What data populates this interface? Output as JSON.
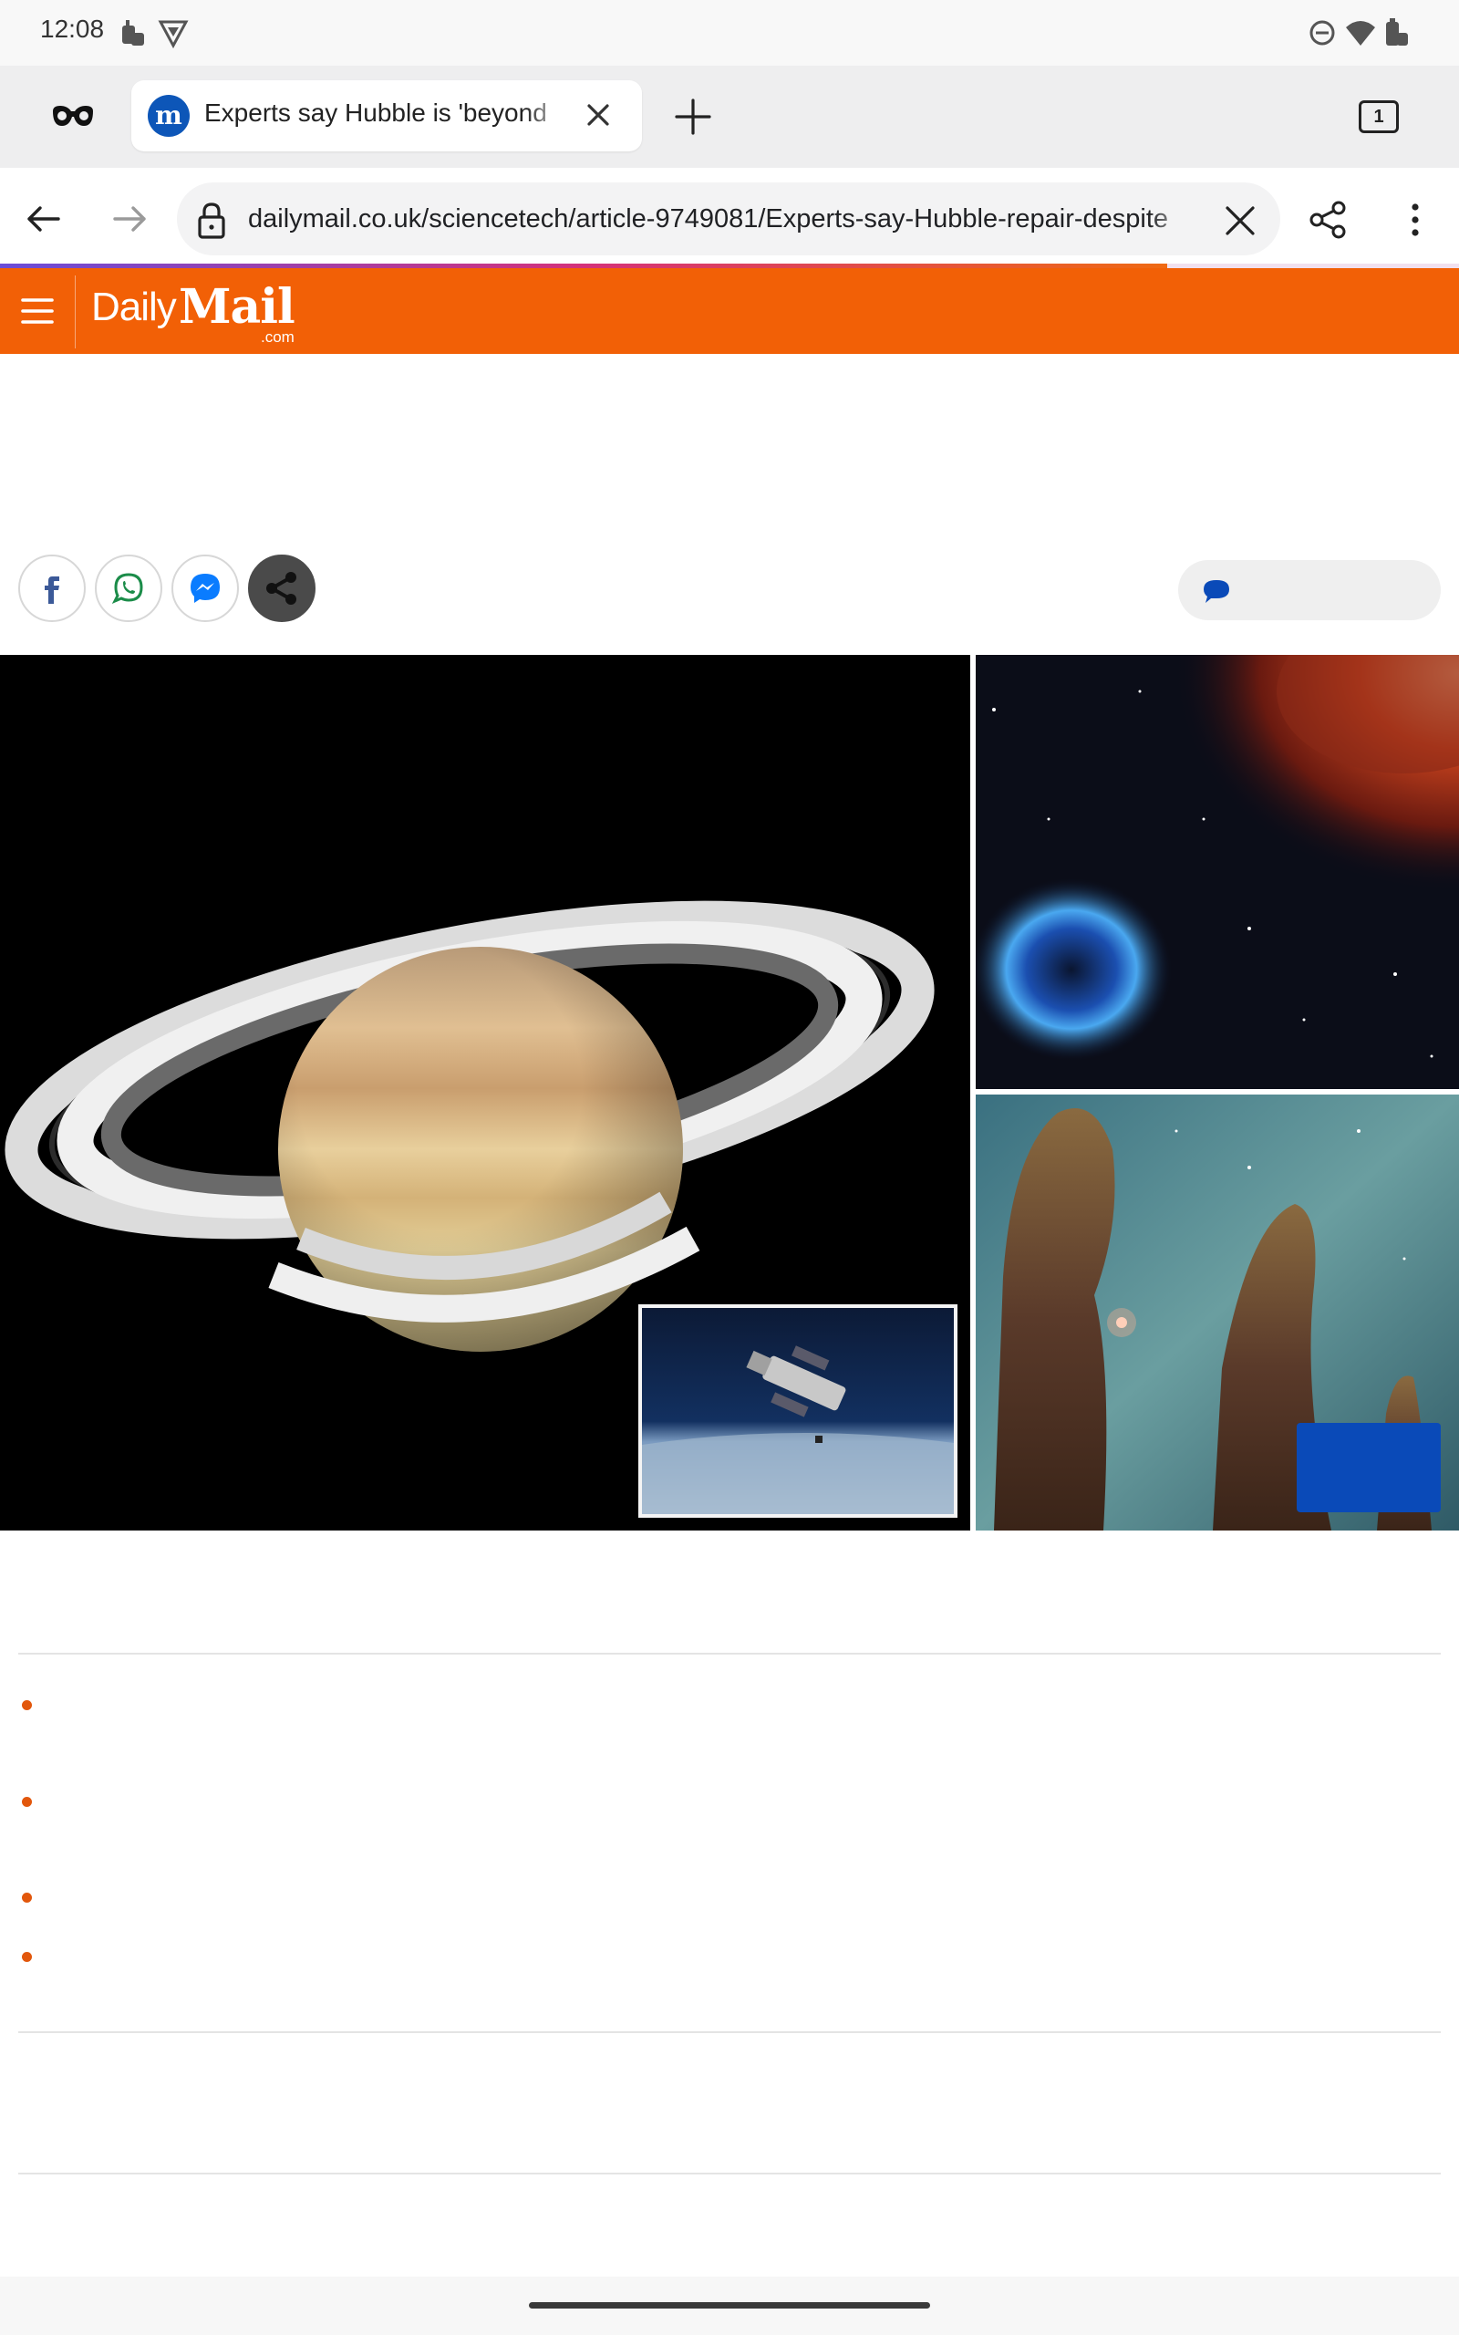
{
  "status_bar": {
    "time": "12:08"
  },
  "tabs": {
    "active_title": "Experts say Hubble is 'beyond",
    "favicon_letter": "m",
    "tab_count": "1"
  },
  "address_bar": {
    "url": "dailymail.co.uk/sciencetech/article-9749081/Experts-say-Hubble-repair-despite"
  },
  "page_load_progress": 0.8,
  "site_header": {
    "logo_daily": "Daily",
    "logo_mail": "Mail",
    "logo_com": ".com"
  },
  "colors": {
    "brand_orange": "#f26006",
    "bullet_orange": "#e2570c",
    "messenger_blue": "#0a7cff",
    "badge_blue": "#0a4ab8"
  },
  "icons": {
    "share_row": [
      "facebook-icon",
      "whatsapp-icon",
      "messenger-icon",
      "share-icon"
    ],
    "comments": "comment-bubble-icon"
  }
}
